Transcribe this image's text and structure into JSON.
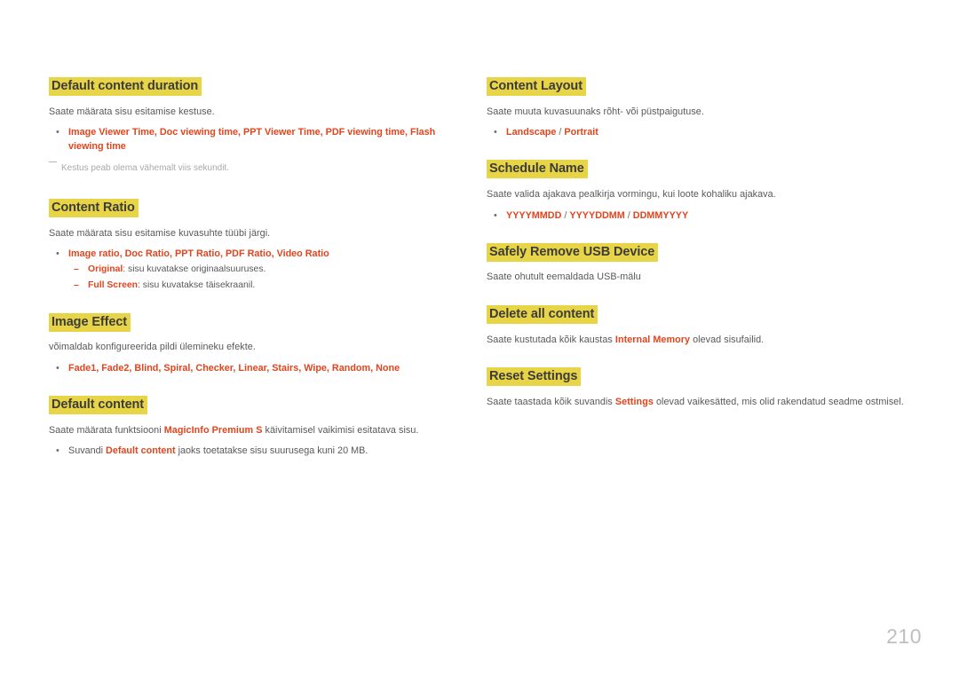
{
  "page": {
    "number": "210"
  },
  "left_column": {
    "sections": [
      {
        "heading": "Default content duration",
        "body": "Saate määrata sisu esitamise kestuse.",
        "bullet_pre": "",
        "bullet_red": "Image Viewer Time, Doc viewing time, PPT Viewer Time, PDF viewing time, Flash viewing time",
        "bullet_post": "",
        "note": "Kestus peab olema vähemalt viis sekundit."
      },
      {
        "heading": "Content Ratio",
        "body": "Saate määrata sisu esitamise kuvasuhte tüübi järgi.",
        "bullet_red": "Image ratio, Doc Ratio, PPT Ratio, PDF Ratio, Video Ratio",
        "sub_items": [
          {
            "term": "Original",
            "text": ": sisu kuvatakse originaalsuuruses."
          },
          {
            "term": "Full Screen",
            "text": ": sisu kuvatakse täisekraanil."
          }
        ]
      },
      {
        "heading": "Image Effect",
        "body": "võimaldab konfigureerida pildi ülemineku efekte.",
        "bullet_red": "Fade1, Fade2, Blind, Spiral, Checker, Linear, Stairs, Wipe, Random, None"
      },
      {
        "heading": "Default content",
        "body_pre": "Saate määrata funktsiooni ",
        "body_red": "MagicInfo Premium S",
        "body_post": " käivitamisel vaikimisi esitatava sisu.",
        "bullet_pre": "Suvandi ",
        "bullet_red": "Default content",
        "bullet_post": " jaoks toetatakse sisu suurusega kuni 20 MB."
      }
    ]
  },
  "right_column": {
    "sections": [
      {
        "heading": "Content Layout",
        "body": "Saate muuta kuvasuunaks rõht- või püstpaigutuse.",
        "options": [
          "Landscape",
          "Portrait"
        ],
        "separator": "/"
      },
      {
        "heading": "Schedule Name",
        "body": "Saate valida ajakava pealkirja vormingu, kui loote kohaliku ajakava.",
        "options": [
          "YYYYMMDD",
          "YYYYDDMM",
          "DDMMYYYY"
        ],
        "separator": "/"
      },
      {
        "heading": "Safely Remove USB Device",
        "body": "Saate ohutult eemaldada USB-mälu"
      },
      {
        "heading": "Delete all content",
        "body_pre": "Saate kustutada kõik kaustas ",
        "body_red": "Internal Memory",
        "body_post": " olevad sisufailid."
      },
      {
        "heading": "Reset Settings",
        "body_pre": "Saate taastada kõik suvandis ",
        "body_red": "Settings",
        "body_post": " olevad vaikesätted, mis olid rakendatud seadme ostmisel."
      }
    ]
  },
  "markers": {
    "bullet": "•",
    "sub_dash": "–"
  }
}
